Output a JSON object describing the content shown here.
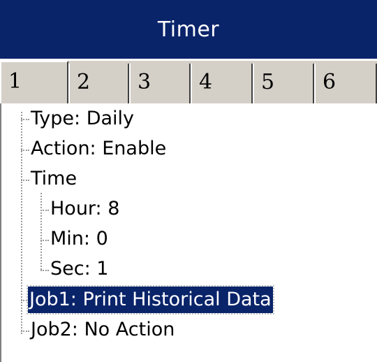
{
  "window": {
    "title": "Timer"
  },
  "tabs": [
    {
      "label": "1",
      "active": true
    },
    {
      "label": "2",
      "active": false
    },
    {
      "label": "3",
      "active": false
    },
    {
      "label": "4",
      "active": false
    },
    {
      "label": "5",
      "active": false
    },
    {
      "label": "6",
      "active": false
    }
  ],
  "tree": {
    "type": "Type: Daily",
    "action": "Action: Enable",
    "time": {
      "label": "Time",
      "hour": "Hour: 8",
      "min": "Min: 0",
      "sec": "Sec: 1"
    },
    "job1": "Job1: Print Historical Data",
    "job2": "Job2: No Action",
    "selected_item": "Job1: Print Historical Data"
  },
  "colors": {
    "titlebar": "#0a246a",
    "selection": "#0a246a",
    "tab_face": "#d4d0c8"
  }
}
